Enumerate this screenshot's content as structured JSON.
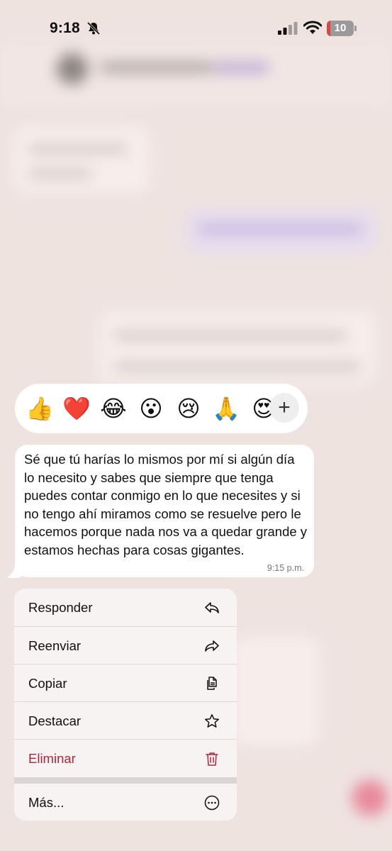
{
  "status_bar": {
    "time": "9:18",
    "battery_level": "10",
    "icons": [
      "bell-slash-icon",
      "signal-icon",
      "wifi-icon",
      "battery-icon"
    ]
  },
  "reactions": {
    "items": [
      {
        "name": "thumbs-up",
        "glyph": "👍"
      },
      {
        "name": "red-heart",
        "glyph": "❤️"
      },
      {
        "name": "tears-of-joy",
        "glyph": "😂"
      },
      {
        "name": "surprised",
        "glyph": "😮"
      },
      {
        "name": "crying",
        "glyph": "😢"
      },
      {
        "name": "folded-hands",
        "glyph": "🙏"
      },
      {
        "name": "heart-eyes",
        "glyph": "😍"
      }
    ],
    "more_label": "+"
  },
  "message": {
    "text": "Sé que tú harías lo mismos por mí si algún día lo necesito y sabes que siempre que tenga puedes contar conmigo en lo que necesites y si no tengo ahí miramos como se resuelve pero le hacemos porque nada nos va a quedar grande y estamos hechas para cosas gigantes.",
    "time": "9:15 p.m."
  },
  "menu": {
    "items": [
      {
        "label": "Responder",
        "icon": "reply-icon"
      },
      {
        "label": "Reenviar",
        "icon": "forward-icon"
      },
      {
        "label": "Copiar",
        "icon": "copy-icon"
      },
      {
        "label": "Destacar",
        "icon": "star-icon"
      },
      {
        "label": "Eliminar",
        "icon": "trash-icon",
        "destructive": true
      },
      {
        "label": "Más...",
        "icon": "more-icon"
      }
    ]
  },
  "colors": {
    "background": "#efe3e0",
    "destructive": "#b0263f",
    "bubble": "#ffffff",
    "menu": "#f6f3f2"
  }
}
